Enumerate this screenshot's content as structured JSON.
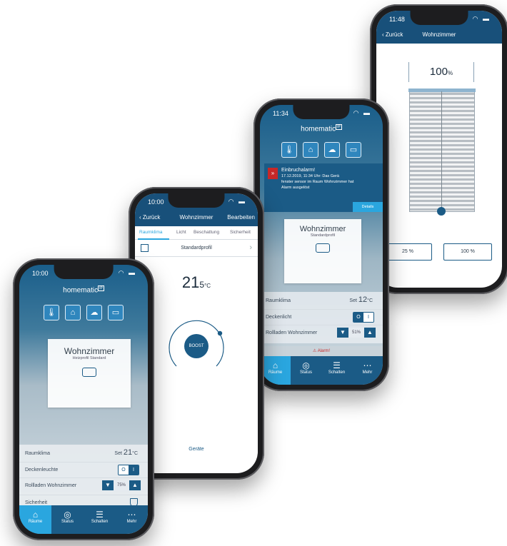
{
  "colors": {
    "navy": "#18507a",
    "accent": "#2aa6df",
    "tabbar": "#1b5b86"
  },
  "phone1": {
    "status": {
      "time": "10:00",
      "icons": "◠ ▬"
    },
    "app_title": "homematic",
    "app_title_badge": "IP",
    "tiles": [
      "thermometer-icon",
      "house-icon",
      "cloud-icon",
      "window-icon"
    ],
    "room": {
      "name": "Wohnzimmer",
      "profile": "Heizprofil Standard"
    },
    "rows": {
      "climate_label": "Raumklima",
      "climate_prefix": "Set",
      "climate_value": "21",
      "climate_unit": "°C",
      "light_label": "Deckenleuchte",
      "off": "O",
      "on": "I",
      "shutter_label": "Rollladen Wohnzimmer",
      "shutter_down": "▼",
      "shutter_pct": "75%",
      "shutter_up": "▲",
      "security_label": "Sicherheit"
    },
    "tabs": [
      {
        "label": "Räume",
        "icon": "⌂"
      },
      {
        "label": "Status",
        "icon": "◎"
      },
      {
        "label": "Schalten",
        "icon": "☰"
      },
      {
        "label": "Mehr",
        "icon": "⋯"
      }
    ]
  },
  "phone2": {
    "status": {
      "time": "10:00",
      "icons": "◠ ▬"
    },
    "nav": {
      "back": "Zurück",
      "title": "Wohnzimmer",
      "action": "Bearbeiten"
    },
    "tabs": [
      "Raumklima",
      "Licht",
      "Beschattung",
      "Sicherheit"
    ],
    "profile": "Standardprofil",
    "temperature": {
      "whole": "21",
      "decimal": "5",
      "unit": "°C"
    },
    "boost": "BOOST",
    "devices": "Geräte"
  },
  "phone3": {
    "status": {
      "time": "11:34",
      "icons": "◠ ▬"
    },
    "app_title": "homematic",
    "app_title_badge": "IP",
    "tiles": [
      "thermometer-icon",
      "house-icon",
      "cloud-icon",
      "window-icon"
    ],
    "alert": {
      "title": "Einbruchalarm!",
      "date": "17.12.2019, 11:34 Uhr: Das Gerä",
      "line2": "fenster sensor im Raum Wohnzimmer hat",
      "line3": "Alarm ausgelöst",
      "details": "Details"
    },
    "room": {
      "name": "Wohnzimmer",
      "profile": "Standardprofil"
    },
    "rows": {
      "climate_label": "Raumklima",
      "climate_prefix": "Set",
      "climate_value": "12",
      "climate_unit": "°C",
      "light_label": "Deckenlicht",
      "off": "O",
      "on": "I",
      "shutter_label": "Rollladen Wohnzimmer",
      "shutter_down": "▼",
      "shutter_pct": "51%",
      "shutter_up": "▲"
    },
    "alarm_text": "Alarm!",
    "tabs": [
      {
        "label": "Räume",
        "icon": "⌂"
      },
      {
        "label": "Status",
        "icon": "◎"
      },
      {
        "label": "Schalten",
        "icon": "☰"
      },
      {
        "label": "Mehr",
        "icon": "⋯"
      }
    ]
  },
  "phone4": {
    "status": {
      "time": "11:48",
      "icons": "◠ ▬"
    },
    "nav": {
      "back": "Zurück",
      "title": "Wohnzimmer"
    },
    "level": {
      "value": "100",
      "unit": "%",
      "fraction": 1.0
    },
    "presets": [
      "25 %",
      "100 %"
    ]
  }
}
